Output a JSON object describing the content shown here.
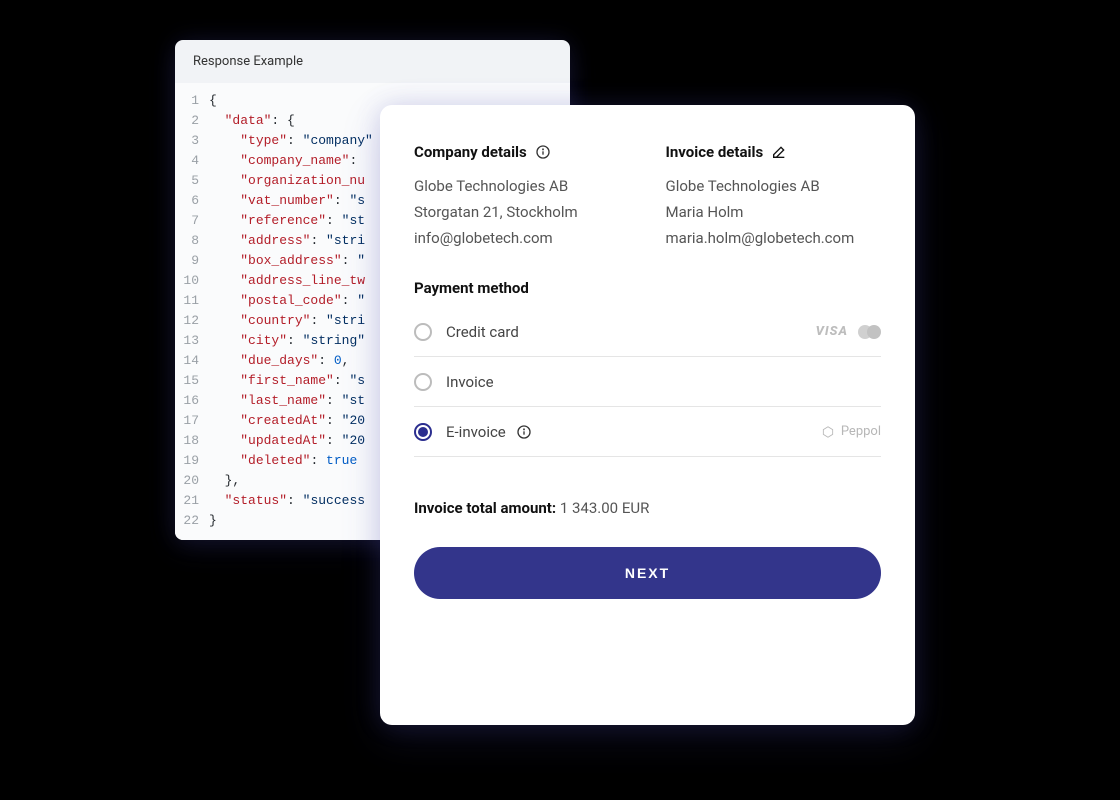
{
  "code": {
    "title": "Response Example",
    "lines": [
      [
        [
          "punct",
          "{"
        ]
      ],
      [
        [
          "punct",
          "  "
        ],
        [
          "key",
          "\"data\""
        ],
        [
          "punct",
          ": {"
        ]
      ],
      [
        [
          "punct",
          "    "
        ],
        [
          "key",
          "\"type\""
        ],
        [
          "punct",
          ": "
        ],
        [
          "str",
          "\"company\""
        ]
      ],
      [
        [
          "punct",
          "    "
        ],
        [
          "key",
          "\"company_name\""
        ],
        [
          "punct",
          ":"
        ]
      ],
      [
        [
          "punct",
          "    "
        ],
        [
          "key",
          "\"organization_nu"
        ]
      ],
      [
        [
          "punct",
          "    "
        ],
        [
          "key",
          "\"vat_number\""
        ],
        [
          "punct",
          ": "
        ],
        [
          "str",
          "\"s"
        ]
      ],
      [
        [
          "punct",
          "    "
        ],
        [
          "key",
          "\"reference\""
        ],
        [
          "punct",
          ": "
        ],
        [
          "str",
          "\"st"
        ]
      ],
      [
        [
          "punct",
          "    "
        ],
        [
          "key",
          "\"address\""
        ],
        [
          "punct",
          ": "
        ],
        [
          "str",
          "\"stri"
        ]
      ],
      [
        [
          "punct",
          "    "
        ],
        [
          "key",
          "\"box_address\""
        ],
        [
          "punct",
          ": "
        ],
        [
          "str",
          "\""
        ]
      ],
      [
        [
          "punct",
          "    "
        ],
        [
          "key",
          "\"address_line_tw"
        ]
      ],
      [
        [
          "punct",
          "    "
        ],
        [
          "key",
          "\"postal_code\""
        ],
        [
          "punct",
          ": "
        ],
        [
          "str",
          "\""
        ]
      ],
      [
        [
          "punct",
          "    "
        ],
        [
          "key",
          "\"country\""
        ],
        [
          "punct",
          ": "
        ],
        [
          "str",
          "\"stri"
        ]
      ],
      [
        [
          "punct",
          "    "
        ],
        [
          "key",
          "\"city\""
        ],
        [
          "punct",
          ": "
        ],
        [
          "str",
          "\"string\""
        ]
      ],
      [
        [
          "punct",
          "    "
        ],
        [
          "key",
          "\"due_days\""
        ],
        [
          "punct",
          ": "
        ],
        [
          "num",
          "0"
        ],
        [
          "punct",
          ","
        ]
      ],
      [
        [
          "punct",
          "    "
        ],
        [
          "key",
          "\"first_name\""
        ],
        [
          "punct",
          ": "
        ],
        [
          "str",
          "\"s"
        ]
      ],
      [
        [
          "punct",
          "    "
        ],
        [
          "key",
          "\"last_name\""
        ],
        [
          "punct",
          ": "
        ],
        [
          "str",
          "\"st"
        ]
      ],
      [
        [
          "punct",
          "    "
        ],
        [
          "key",
          "\"createdAt\""
        ],
        [
          "punct",
          ": "
        ],
        [
          "str",
          "\"20"
        ]
      ],
      [
        [
          "punct",
          "    "
        ],
        [
          "key",
          "\"updatedAt\""
        ],
        [
          "punct",
          ": "
        ],
        [
          "str",
          "\"20"
        ]
      ],
      [
        [
          "punct",
          "    "
        ],
        [
          "key",
          "\"deleted\""
        ],
        [
          "punct",
          ": "
        ],
        [
          "bool",
          "true"
        ]
      ],
      [
        [
          "punct",
          "  },"
        ]
      ],
      [
        [
          "punct",
          "  "
        ],
        [
          "key",
          "\"status\""
        ],
        [
          "punct",
          ": "
        ],
        [
          "str",
          "\"success"
        ]
      ],
      [
        [
          "punct",
          "}"
        ]
      ]
    ]
  },
  "company": {
    "heading": "Company details",
    "name": "Globe Technologies AB",
    "address": "Storgatan 21, Stockholm",
    "email": "info@globetech.com"
  },
  "invoice": {
    "heading": "Invoice details",
    "name": "Globe Technologies AB",
    "contact": "Maria Holm",
    "email": "maria.holm@globetech.com"
  },
  "payment": {
    "heading": "Payment method",
    "options": {
      "credit_card": "Credit card",
      "invoice": "Invoice",
      "e_invoice": "E-invoice"
    },
    "selected": "e_invoice",
    "peppol_label": "Peppol",
    "visa_label": "VISA"
  },
  "total": {
    "label": "Invoice total amount:",
    "value": "1 343.00 EUR"
  },
  "next_label": "NEXT"
}
